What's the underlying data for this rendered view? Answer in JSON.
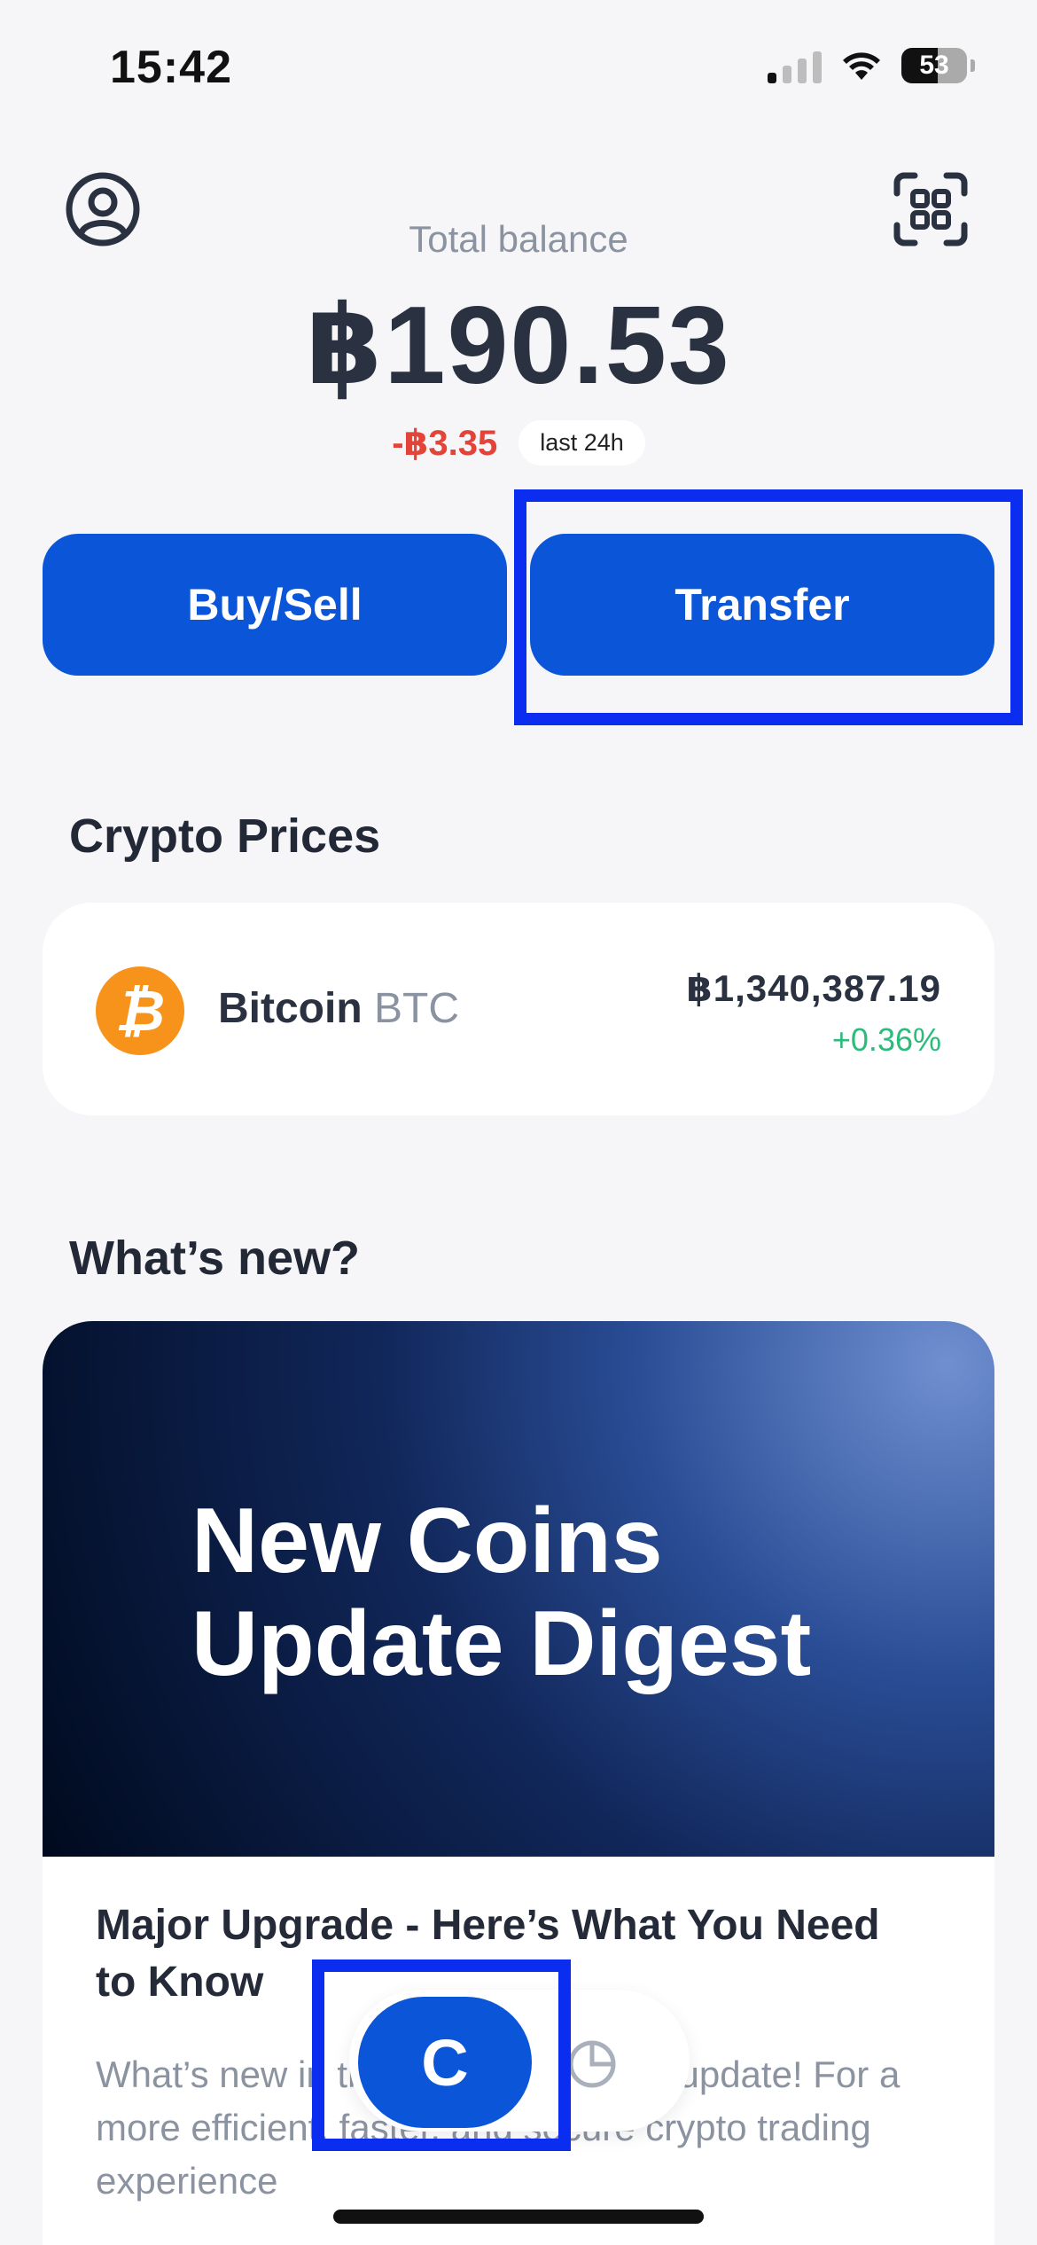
{
  "status_bar": {
    "time": "15:42",
    "battery": "53"
  },
  "header": {
    "balance_label": "Total balance",
    "balance_value": "฿190.53",
    "change_value": "-฿3.35",
    "change_period": "last 24h"
  },
  "actions": {
    "buy_sell": "Buy/Sell",
    "transfer": "Transfer"
  },
  "prices": {
    "title": "Crypto Prices",
    "coin": {
      "name": "Bitcoin",
      "symbol": "BTC",
      "price": "฿1,340,387.19",
      "change": "+0.36%",
      "icon_glyph": "₿"
    }
  },
  "whats_new": {
    "title": "What’s new?",
    "banner_headline_line1": "New Coins",
    "banner_headline_line2": "Update Digest",
    "article_title": "Major Upgrade - Here’s What You Need to Know",
    "article_desc": "What’s new in the ...s.co.th system update! For a more efficient, faster, and secure crypto trading experience"
  },
  "nav": {
    "home_glyph": "C"
  },
  "colors": {
    "accent": "#0a55d8",
    "negative": "#e2443a",
    "positive": "#2bbb7a",
    "highlight": "#0b2df0"
  }
}
